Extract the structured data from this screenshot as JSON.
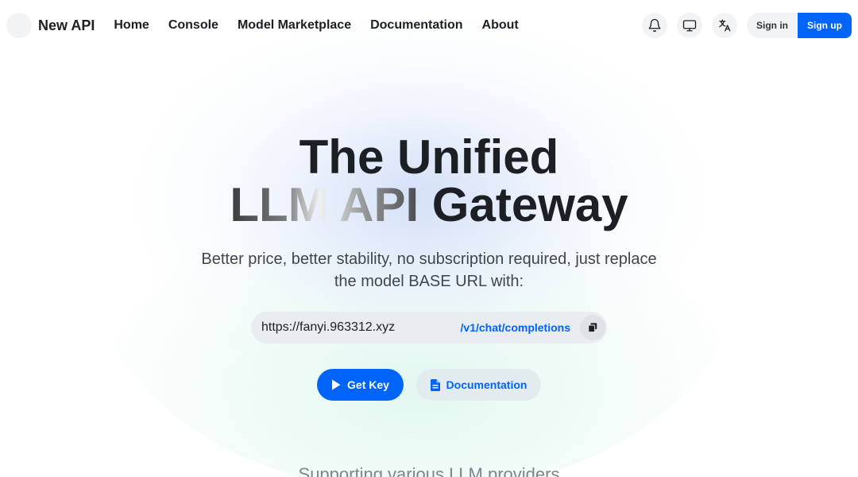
{
  "header": {
    "brand": "New API",
    "nav": [
      {
        "label": "Home"
      },
      {
        "label": "Console"
      },
      {
        "label": "Model Marketplace"
      },
      {
        "label": "Documentation"
      },
      {
        "label": "About"
      }
    ],
    "icons": [
      "bell-icon",
      "monitor-icon",
      "translate-icon"
    ],
    "signin_label": "Sign in",
    "signup_label": "Sign up"
  },
  "hero": {
    "title_line1": "The Unified",
    "title_line2_highlight": "LLM API",
    "title_line2_rest": " Gateway",
    "subtitle": "Better price, better stability, no subscription required, just replace the model BASE URL with:",
    "base_url": "https://fanyi.963312.xyz",
    "endpoint": "/v1/chat/completions",
    "get_key_label": "Get Key",
    "docs_label": "Documentation",
    "providers_heading": "Supporting various LLM providers"
  },
  "colors": {
    "accent": "#0064fa",
    "text": "#1c1f23",
    "muted": "#41464c"
  }
}
